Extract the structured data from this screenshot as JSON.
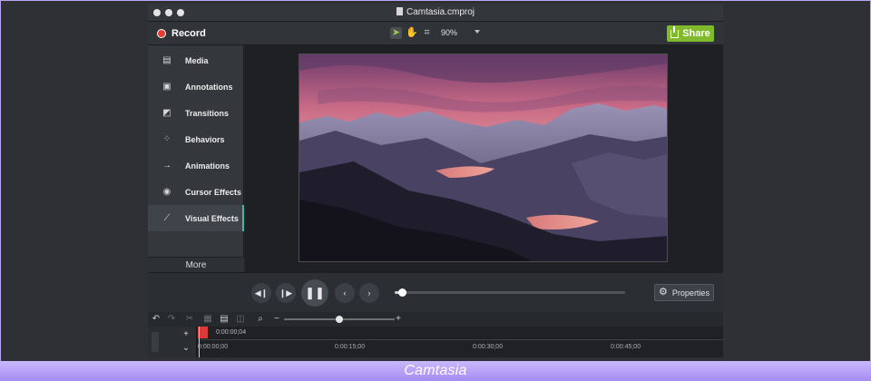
{
  "app": {
    "document_title": "Camtasia.cmproj",
    "caption": "Camtasia"
  },
  "toolbar": {
    "record_label": "Record",
    "zoom_value": "90%",
    "share_label": "Share",
    "tools": [
      "select-tool-icon",
      "pan-hand-icon",
      "crop-icon"
    ]
  },
  "sidebar": {
    "items": [
      {
        "label": "Media",
        "icon": "media-filmstrip-icon"
      },
      {
        "label": "Annotations",
        "icon": "annotation-icon"
      },
      {
        "label": "Transitions",
        "icon": "transition-icon"
      },
      {
        "label": "Behaviors",
        "icon": "behaviors-icon"
      },
      {
        "label": "Animations",
        "icon": "animation-arrow-icon"
      },
      {
        "label": "Cursor Effects",
        "icon": "cursor-effects-icon"
      },
      {
        "label": "Visual Effects",
        "icon": "magic-wand-icon"
      }
    ],
    "selected": "Visual Effects",
    "more_label": "More"
  },
  "playback": {
    "progress": 0.03,
    "properties_label": "Properties"
  },
  "timeline": {
    "zoom_level": 0.5,
    "playhead_time": "0:00:00;04",
    "ticks": [
      "0:00:00;00",
      "0:00:15;00",
      "0:00:30;00",
      "0:00:45;00"
    ]
  },
  "colors": {
    "record_dot": "#e43b33",
    "share_button": "#80b92b",
    "selected_accent": "#3dbba8",
    "caption_bar": "#a58cf3"
  }
}
